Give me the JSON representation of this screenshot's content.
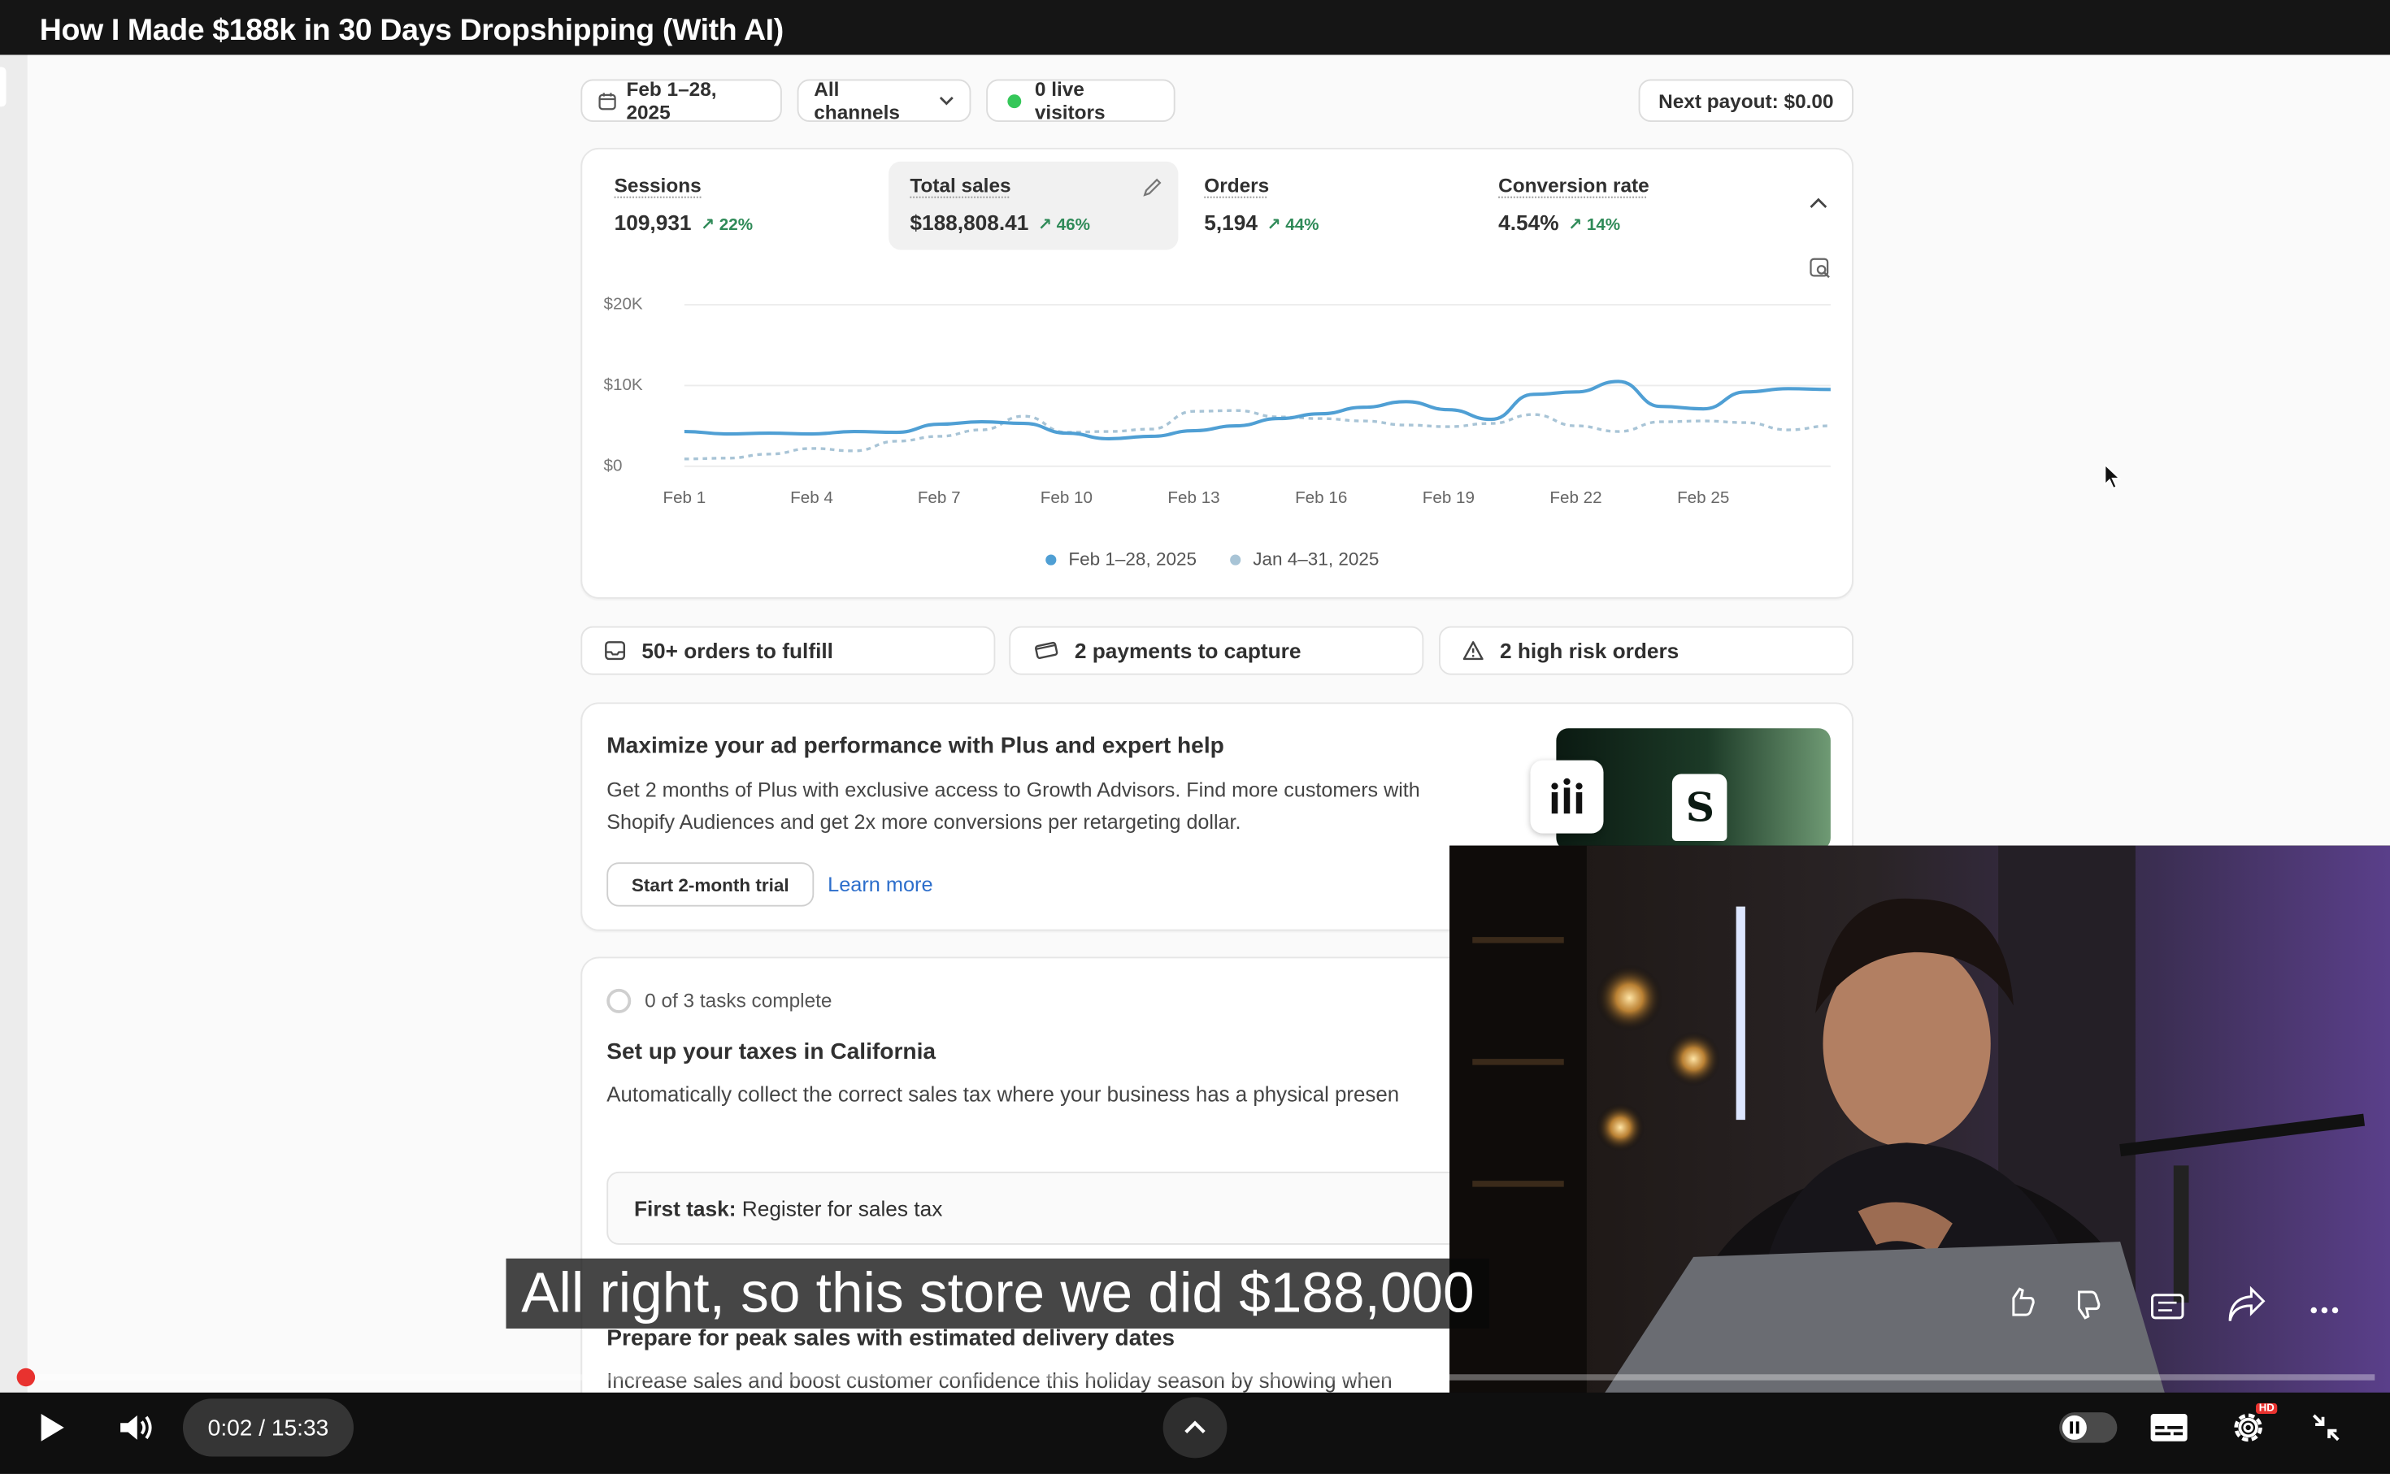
{
  "video": {
    "title": "How I Made $188k in 30 Days Dropshipping (With AI)",
    "caption": "All right, so this store we did $188,000",
    "time_current": "0:02",
    "time_total": "15:33",
    "progress_fraction": 0.002,
    "hd_badge": "HD"
  },
  "toolbar": {
    "date_range": "Feb 1–28, 2025",
    "channels": "All channels",
    "live_visitors": "0 live visitors",
    "next_payout": "Next payout: $0.00"
  },
  "metrics": [
    {
      "label": "Sessions",
      "value": "109,931",
      "change": "22%"
    },
    {
      "label": "Total sales",
      "value": "$188,808.41",
      "change": "46%"
    },
    {
      "label": "Orders",
      "value": "5,194",
      "change": "44%"
    },
    {
      "label": "Conversion rate",
      "value": "4.54%",
      "change": "14%"
    }
  ],
  "chart_data": {
    "type": "line",
    "title": "",
    "xlabel": "",
    "ylabel": "",
    "y_ticks": [
      "$20K",
      "$10K",
      "$0"
    ],
    "ylim": [
      0,
      20000
    ],
    "x_ticks": [
      "Feb 1",
      "Feb 4",
      "Feb 7",
      "Feb 10",
      "Feb 13",
      "Feb 16",
      "Feb 19",
      "Feb 22",
      "Feb 25"
    ],
    "grid": true,
    "legend_position": "bottom",
    "series": [
      {
        "name": "Feb 1–28, 2025",
        "color": "#4f9fd4",
        "style": "solid",
        "x": [
          1,
          2,
          3,
          4,
          5,
          6,
          7,
          8,
          9,
          10,
          11,
          12,
          13,
          14,
          15,
          16,
          17,
          18,
          19,
          20,
          21,
          22,
          23,
          24,
          25,
          26,
          27,
          28
        ],
        "values": [
          4300,
          4000,
          4100,
          4000,
          4300,
          4200,
          5200,
          5500,
          5300,
          4100,
          3400,
          3700,
          4400,
          5000,
          5900,
          6500,
          7300,
          8000,
          7000,
          5800,
          8900,
          9200,
          10500,
          7400,
          7100,
          9200,
          9600,
          9500
        ]
      },
      {
        "name": "Jan 4–31, 2025",
        "color": "#a8c4d6",
        "style": "dashed",
        "x": [
          1,
          2,
          3,
          4,
          5,
          6,
          7,
          8,
          9,
          10,
          11,
          12,
          13,
          14,
          15,
          16,
          17,
          18,
          19,
          20,
          21,
          22,
          23,
          24,
          25,
          26,
          27,
          28
        ],
        "values": [
          900,
          1000,
          1500,
          2200,
          1900,
          3100,
          3700,
          4500,
          6200,
          4200,
          4300,
          4600,
          6800,
          6900,
          6100,
          5900,
          5600,
          5100,
          4900,
          5300,
          6400,
          5000,
          4300,
          5500,
          5600,
          5400,
          4500,
          5000
        ]
      }
    ]
  },
  "alerts": [
    {
      "label": "50+ orders to fulfill",
      "icon": "inbox-icon"
    },
    {
      "label": "2 payments to capture",
      "icon": "credit-card-icon"
    },
    {
      "label": "2 high risk orders",
      "icon": "warning-icon"
    }
  ],
  "promo": {
    "title": "Maximize your ad performance with Plus and expert help",
    "body": "Get 2 months of Plus with exclusive access to Growth Advisors. Find more customers with Shopify Audiences and get 2x more conversions per retargeting dollar.",
    "primary_button": "Start 2-month trial",
    "link": "Learn more"
  },
  "setup": {
    "progress": "0 of 3 tasks complete",
    "title": "Set up your taxes in California",
    "body": "Automatically collect the correct sales tax where your business has a physical presen",
    "first_task_label": "First task:",
    "first_task": "Register for sales tax"
  },
  "next_section": {
    "title": "Prepare for peak sales with estimated delivery dates",
    "body": "Increase sales and boost customer confidence this holiday season by showing when"
  },
  "colors": {
    "accent_blue": "#4f9fd4",
    "positive_green": "#2f8a58",
    "progress_red": "#e8322f",
    "link_blue": "#2c6ecb"
  }
}
